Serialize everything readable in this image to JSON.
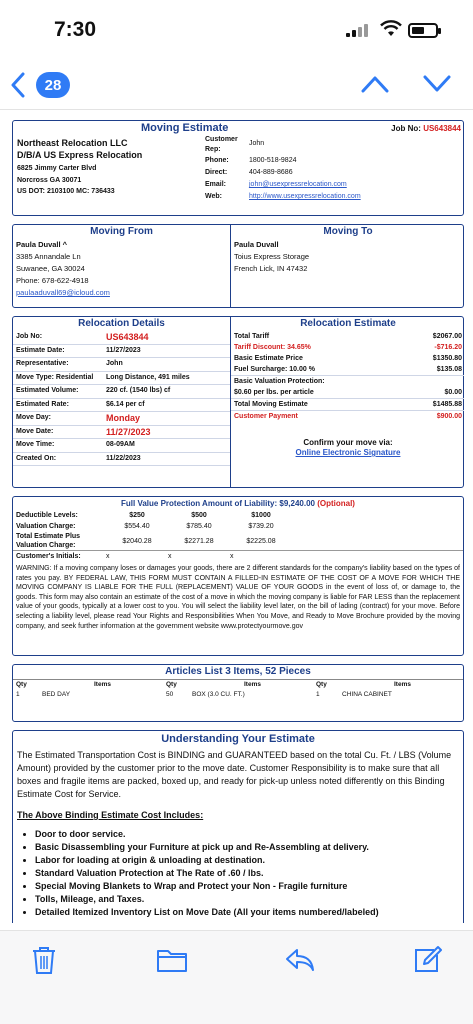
{
  "status": {
    "time": "7:30"
  },
  "nav": {
    "badge_count": "28"
  },
  "header": {
    "title": "Moving Estimate",
    "job_label": "Job No:",
    "job_no": "US643844",
    "company": [
      "Northeast Relocation LLC",
      "D/B/A US Express Relocation"
    ],
    "address1": "6825 Jimmy Carter Blvd",
    "address2": "Norcross GA 30071",
    "dot": "US DOT: 2103100   MC: 736433",
    "rep_label": "Customer Rep:",
    "rep": "John",
    "phone_label": "Phone:",
    "phone": "1800-518-9824",
    "direct_label": "Direct:",
    "direct": "404-889-8686",
    "email_label": "Email:",
    "email": "john@usexpressrelocation.com",
    "web_label": "Web:",
    "web": "http://www.usexpressrelocation.com"
  },
  "moving_from": {
    "heading": "Moving From",
    "name": "Paula Duvall ^",
    "street": "3385 Annandale Ln",
    "city": "Suwanee, GA 30024",
    "phone": "Phone: 678-622-4918",
    "email": "paulaaduvall69@icloud.com"
  },
  "moving_to": {
    "heading": "Moving To",
    "name": "Paula Duvall",
    "street": "Toius Express Storage",
    "city": "French Lick, IN 47432"
  },
  "relocation_details": {
    "heading": "Relocation Details",
    "rows": [
      {
        "k": "Job No:",
        "v": "US643844"
      },
      {
        "k": "Estimate Date:",
        "v": "11/27/2023"
      },
      {
        "k": "Representative:",
        "v": "John"
      },
      {
        "k": "Move Type: Residential",
        "v": "Long Distance, 491 miles"
      },
      {
        "k": "Estimated Volume:",
        "v": "220 cf. (1540 lbs) cf"
      },
      {
        "k": "Estimated Rate:",
        "v": "$6.14 per cf"
      },
      {
        "k": "Move Day:",
        "v": "Monday"
      },
      {
        "k": "Move Date:",
        "v": "11/27/2023"
      },
      {
        "k": "Move Time:",
        "v": "08-09AM"
      },
      {
        "k": "Created On:",
        "v": "11/22/2023"
      }
    ]
  },
  "relocation_estimate": {
    "heading": "Relocation Estimate",
    "rows": [
      {
        "k": "Total Tariff",
        "v": "$2067.00"
      },
      {
        "k": "Tariff Discount: 34.65%",
        "v": "-$716.20"
      },
      {
        "k": "Basic Estimate Price",
        "v": "$1350.80"
      },
      {
        "k": "Fuel Surcharge: 10.00 %",
        "v": "$135.08"
      },
      {
        "k": "Basic Valuation Protection:",
        "v": ""
      },
      {
        "k": "$0.60 per lbs. per article",
        "v": "$0.00"
      },
      {
        "k": "Total Moving Estimate",
        "v": "$1485.88"
      },
      {
        "k": "Customer Payment",
        "v": "$900.00"
      }
    ],
    "confirm": "Confirm your move via:",
    "confirm_link": "Online Electronic Signature"
  },
  "liability": {
    "title": "Full Value Protection Amount of Liability: $9,240.00",
    "optional": "(Optional)",
    "deductible_label": "Deductible Levels:",
    "deductibles": [
      "$250",
      "$500",
      "$1000"
    ],
    "valuation_label": "Valuation Charge:",
    "valuation": [
      "$554.40",
      "$785.40",
      "$739.20"
    ],
    "total_label": "Total Estimate Plus Valuation Charge:",
    "totals": [
      "$2040.28",
      "$2271.28",
      "$2225.08"
    ],
    "initials_label": "Customer's Initials:",
    "initials": [
      "x",
      "x",
      "x"
    ],
    "warning": "WARNING: If a moving company loses or damages your goods, there are 2 different standards for the company's liability based on the types of rates you pay. BY FEDERAL LAW, THIS FORM MUST CONTAIN A FILLED-IN ESTIMATE OF THE COST OF A MOVE FOR WHICH THE MOVING COMPANY IS LIABLE FOR THE FULL (REPLACEMENT) VALUE OF YOUR GOODS in the event of loss of, or damage to, the goods. This form may also contain an estimate of the cost of a move in which the moving company is liable for FAR LESS than the replacement value of your goods, typically at a lower cost to you. You will select the liability level later, on the bill of lading (contract) for your move. Before selecting a liability level, please read Your Rights and Responsibilities When You Move, and Ready to Move Brochure provided by the moving company, and seek further information at the government website www.protectyourmove.gov"
  },
  "articles": {
    "heading": "Articles List 3 Items, 52 Pieces",
    "col_qty": "Qty",
    "col_items": "Items",
    "items": [
      {
        "qty": "1",
        "name": "BED DAY"
      },
      {
        "qty": "50",
        "name": "BOX (3.0 CU. FT.)"
      },
      {
        "qty": "1",
        "name": "CHINA CABINET"
      }
    ]
  },
  "understanding": {
    "heading": "Understanding Your Estimate",
    "para": "The Estimated Transportation Cost is BINDING and GUARANTEED based on the total Cu. Ft. / LBS (Volume Amount) provided by the customer prior to the move date. Customer Responsibility is to make sure that all boxes and fragile items are packed, boxed up, and ready for pick-up unless noted differently on this Binding Estimate Cost for Service.",
    "includes": "The Above Binding Estimate Cost Includes:",
    "bullets": [
      "Door to door service.",
      "Basic Disassembling your Furniture at pick up and Re-Assembling at delivery.",
      "Labor for loading at origin & unloading at destination.",
      "Standard Valuation Protection at The Rate of .60 / lbs.",
      "Special Moving Blankets to Wrap and Protect your Non - Fragile furniture",
      "Tolls, Mileage, and Taxes.",
      "Detailed Itemized Inventory List on Move Date (All your items numbered/labeled)"
    ]
  },
  "colors": {
    "accent": "#2f7bf5",
    "doc_blue": "#1e3f8a",
    "red": "#d32020"
  }
}
